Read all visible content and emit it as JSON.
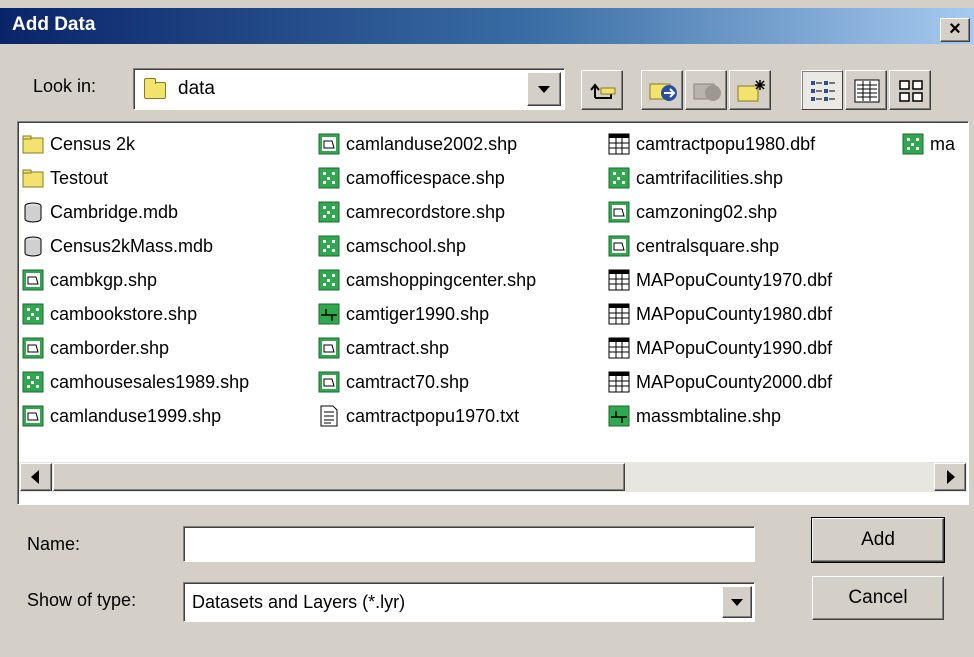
{
  "window": {
    "title": "Add Data",
    "close_glyph": "×"
  },
  "look_in": {
    "label": "Look in:",
    "value": "data"
  },
  "toolbar": [
    {
      "name": "up-one-level",
      "icon": "up-folder-icon"
    },
    {
      "name": "connect-to-folder",
      "icon": "connect-folder-icon"
    },
    {
      "name": "disconnect-from-folder",
      "icon": "disconnect-folder-icon"
    },
    {
      "name": "new-folder",
      "icon": "new-folder-icon"
    },
    {
      "name": "list-view",
      "icon": "list-view-icon"
    },
    {
      "name": "details-view",
      "icon": "details-view-icon"
    },
    {
      "name": "thumbnails-view",
      "icon": "thumbnails-view-icon"
    }
  ],
  "files": [
    [
      {
        "name": "Census 2k",
        "icon": "folder-icon"
      },
      {
        "name": "Testout",
        "icon": "folder-icon"
      },
      {
        "name": "Cambridge.mdb",
        "icon": "geodatabase-icon"
      },
      {
        "name": "Census2kMass.mdb",
        "icon": "geodatabase-icon"
      },
      {
        "name": "cambkgp.shp",
        "icon": "polygon-shapefile-icon"
      },
      {
        "name": "cambookstore.shp",
        "icon": "point-shapefile-icon"
      },
      {
        "name": "camborder.shp",
        "icon": "polygon-shapefile-icon"
      },
      {
        "name": "camhousesales1989.shp",
        "icon": "point-shapefile-icon"
      },
      {
        "name": "camlanduse1999.shp",
        "icon": "polygon-shapefile-icon"
      }
    ],
    [
      {
        "name": "camlanduse2002.shp",
        "icon": "polygon-shapefile-icon"
      },
      {
        "name": "camofficespace.shp",
        "icon": "point-shapefile-icon"
      },
      {
        "name": "camrecordstore.shp",
        "icon": "point-shapefile-icon"
      },
      {
        "name": "camschool.shp",
        "icon": "point-shapefile-icon"
      },
      {
        "name": "camshoppingcenter.shp",
        "icon": "point-shapefile-icon"
      },
      {
        "name": "camtiger1990.shp",
        "icon": "line-shapefile-icon"
      },
      {
        "name": "camtract.shp",
        "icon": "polygon-shapefile-icon"
      },
      {
        "name": "camtract70.shp",
        "icon": "polygon-shapefile-icon"
      },
      {
        "name": "camtractpopu1970.txt",
        "icon": "text-file-icon"
      }
    ],
    [
      {
        "name": "camtractpopu1980.dbf",
        "icon": "table-icon"
      },
      {
        "name": "camtrifacilities.shp",
        "icon": "point-shapefile-icon"
      },
      {
        "name": "camzoning02.shp",
        "icon": "polygon-shapefile-icon"
      },
      {
        "name": "centralsquare.shp",
        "icon": "polygon-shapefile-icon"
      },
      {
        "name": "MAPopuCounty1970.dbf",
        "icon": "table-icon"
      },
      {
        "name": "MAPopuCounty1980.dbf",
        "icon": "table-icon"
      },
      {
        "name": "MAPopuCounty1990.dbf",
        "icon": "table-icon"
      },
      {
        "name": "MAPopuCounty2000.dbf",
        "icon": "table-icon"
      },
      {
        "name": "massmbtaline.shp",
        "icon": "line-shapefile-icon"
      }
    ],
    [
      {
        "name": "ma",
        "icon": "point-shapefile-icon"
      }
    ]
  ],
  "name_field": {
    "label": "Name:",
    "value": ""
  },
  "type_field": {
    "label": "Show of type:",
    "value": "Datasets and Layers (*.lyr)"
  },
  "buttons": {
    "add": "Add",
    "cancel": "Cancel"
  },
  "colors": {
    "title_start": "#0a246a",
    "title_end": "#a6caf0",
    "dialog_bg": "#d4d0c8",
    "shapefile_green": "#2fa84f"
  }
}
